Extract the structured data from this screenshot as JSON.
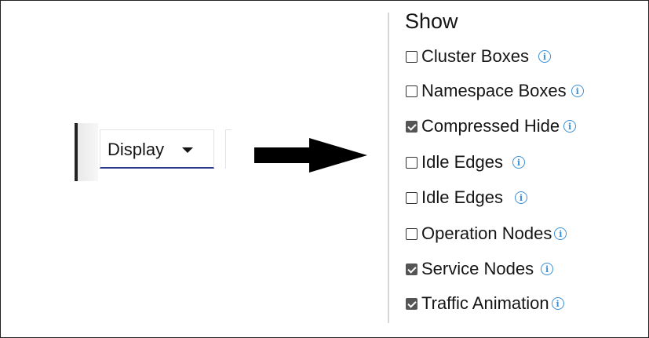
{
  "toolbar": {
    "display_label": "Display",
    "display_icon": "caret-down-icon"
  },
  "arrow_icon": "right-arrow-icon",
  "show_panel": {
    "title": "Show",
    "options": [
      {
        "label": "Cluster Boxes",
        "checked": false,
        "info_icon": "info-icon"
      },
      {
        "label": "Namespace Boxes",
        "checked": false,
        "info_icon": "info-icon"
      },
      {
        "label": "Compressed Hide",
        "checked": true,
        "info_icon": "info-icon"
      },
      {
        "label": "Idle Edges",
        "checked": false,
        "info_icon": "info-icon"
      },
      {
        "label": "Idle Edges",
        "checked": false,
        "info_icon": "info-icon"
      },
      {
        "label": "Operation Nodes",
        "checked": false,
        "info_icon": "info-icon"
      },
      {
        "label": "Service Nodes",
        "checked": true,
        "info_icon": "info-icon"
      },
      {
        "label": "Traffic Animation",
        "checked": true,
        "info_icon": "info-icon"
      }
    ]
  },
  "colors": {
    "accent_underline": "#2b3a8f",
    "info_icon": "#3b8fd6",
    "checkbox_checked": "#555555"
  }
}
